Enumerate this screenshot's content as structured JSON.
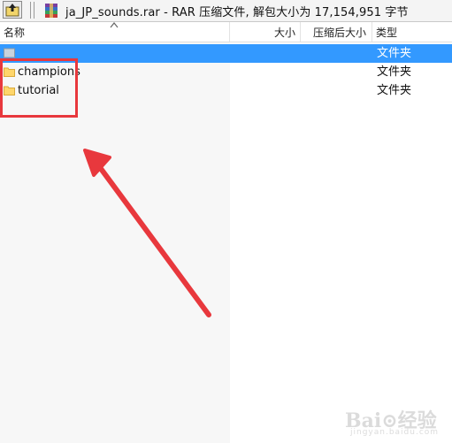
{
  "window": {
    "path_title": "ja_JP_sounds.rar - RAR 压缩文件, 解包大小为 17,154,951 字节"
  },
  "columns": {
    "name": "名称",
    "size": "大小",
    "packed": "压缩后大小",
    "type": "类型"
  },
  "rows": [
    {
      "name": "",
      "type": "文件夹"
    },
    {
      "name": "champions",
      "type": "文件夹"
    },
    {
      "name": "tutorial",
      "type": "文件夹"
    }
  ],
  "watermark": {
    "text": "Bai⊙经验",
    "sub": "jingyan.baidu.com"
  },
  "colors": {
    "selection": "#3399ff",
    "annotation": "#e8383d",
    "folder": "#ffd66b"
  },
  "icons": {
    "up": "up-folder-icon",
    "archive": "rar-archive-icon",
    "folder": "folder-icon"
  }
}
